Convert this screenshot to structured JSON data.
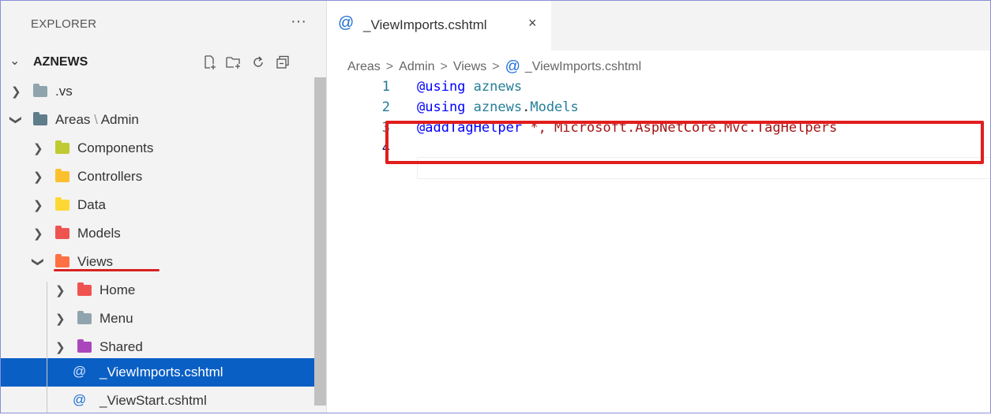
{
  "explorer": {
    "title": "EXPLORER",
    "more_label": "···",
    "root": {
      "label": "AZNEWS",
      "expanded": true
    },
    "actions": [
      "new-file-icon",
      "new-folder-icon",
      "refresh-icon",
      "collapse-all-icon"
    ],
    "items": [
      {
        "label": ".vs",
        "type": "folder",
        "icon": "folder-icon",
        "color": "#90a4ae",
        "expanded": false,
        "depth": 1
      },
      {
        "label_a": "Areas",
        "label_sep": "\\",
        "label_b": "Admin",
        "type": "folder",
        "icon": "folder-icon",
        "color": "#607d8b",
        "expanded": true,
        "depth": 1
      },
      {
        "label": "Components",
        "type": "folder",
        "icon": "components-folder-icon",
        "color": "#c0ca33",
        "expanded": false,
        "depth": 2
      },
      {
        "label": "Controllers",
        "type": "folder",
        "icon": "controllers-folder-icon",
        "color": "#fbc02d",
        "expanded": false,
        "depth": 2
      },
      {
        "label": "Data",
        "type": "folder",
        "icon": "data-folder-icon",
        "color": "#fdd835",
        "expanded": false,
        "depth": 2
      },
      {
        "label": "Models",
        "type": "folder",
        "icon": "models-folder-icon",
        "color": "#ef5350",
        "expanded": false,
        "depth": 2
      },
      {
        "label": "Views",
        "type": "folder",
        "icon": "views-folder-icon",
        "color": "#ff7043",
        "expanded": true,
        "depth": 2
      },
      {
        "label": "Home",
        "type": "folder",
        "icon": "home-folder-icon",
        "color": "#ef5350",
        "expanded": false,
        "depth": 3
      },
      {
        "label": "Menu",
        "type": "folder",
        "icon": "folder-icon",
        "color": "#90a4ae",
        "expanded": false,
        "depth": 3
      },
      {
        "label": "Shared",
        "type": "folder",
        "icon": "shared-folder-icon",
        "color": "#ab47bc",
        "expanded": false,
        "depth": 3
      },
      {
        "label": "_ViewImports.cshtml",
        "type": "file",
        "icon": "razor-file-icon",
        "selected": true,
        "depth": 3
      },
      {
        "label": "_ViewStart.cshtml",
        "type": "file",
        "icon": "razor-file-icon",
        "selected": false,
        "depth": 3
      }
    ]
  },
  "editor": {
    "tab": {
      "icon": "@",
      "name": "_ViewImports.cshtml",
      "close": "×"
    },
    "breadcrumb": [
      "Areas",
      "Admin",
      "Views",
      "_ViewImports.cshtml"
    ],
    "breadcrumb_sep": ">",
    "breadcrumb_file_icon": "@",
    "lines": [
      {
        "n": "1",
        "tokens": [
          {
            "t": "@using",
            "c": "dir"
          },
          {
            "t": " ",
            "c": "plain"
          },
          {
            "t": "aznews",
            "c": "ns"
          }
        ]
      },
      {
        "n": "2",
        "tokens": [
          {
            "t": "@using",
            "c": "dir"
          },
          {
            "t": " ",
            "c": "plain"
          },
          {
            "t": "aznews",
            "c": "ns"
          },
          {
            "t": ".",
            "c": "plain"
          },
          {
            "t": "Models",
            "c": "ns"
          }
        ]
      },
      {
        "n": "3",
        "tokens": [
          {
            "t": "@addTagHelper",
            "c": "dir"
          },
          {
            "t": " ",
            "c": "plain"
          },
          {
            "t": "*",
            "c": "star"
          },
          {
            "t": ", ",
            "c": "id"
          },
          {
            "t": "Microsoft.AspNetCore.Mvc.TagHelpers",
            "c": "id"
          }
        ]
      },
      {
        "n": "4",
        "tokens": []
      }
    ],
    "active_line": "4"
  },
  "colors": {
    "selection": "#0a5fc4",
    "annotation_red": "#e11d1d",
    "razor_blue": "#1e6fd6"
  }
}
